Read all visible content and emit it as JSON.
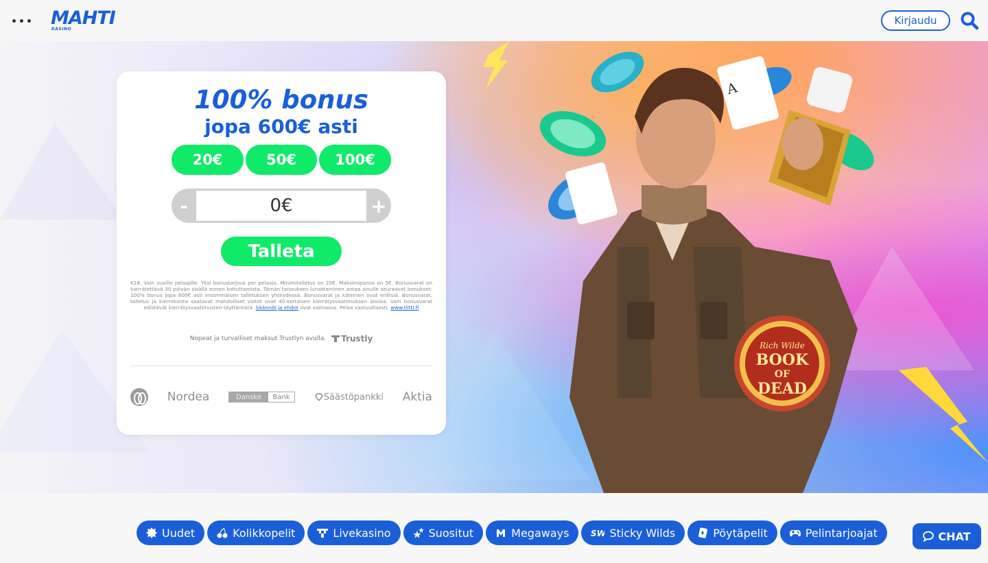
{
  "header": {
    "brand": "MAHTI",
    "brand_sub": "KASINO",
    "login_label": "Kirjaudu"
  },
  "promo": {
    "title": "100% bonus",
    "subtitle": "jopa 600€ asti",
    "amounts": [
      "20€",
      "50€",
      "100€"
    ],
    "stepper": {
      "value": "0€",
      "minus": "-",
      "plus": "+"
    },
    "deposit_label": "Talleta",
    "terms_text": "K18. Vain uusille pelaajille. Yksi bonustarjous per pelaaja. Minimitalletus on 20€. Maksimipanos on 5€. Bonusvarat on kierrätettävä 30 päivän sisällä ennen kotiuttamista. Tämän tarjouksen lunastaminen antaa sinulle seuraavat bonukset: 100% bonus jopa 600€ asti ensimmäisen talletuksen yhteydessä. Bonusvarat ja käteinen ovat erillisiä. Bonusvarat, talletus ja kierroksista saatavat mahdolliset voitot ovat 40-kertaisen kierrätysvaatimuksen alaisia. Vain bonusvarat edistävät kierrätysvaatimusten täyttämistä.",
    "terms_link": "Säännöt ja ehdot",
    "terms_tail": "ovat voimassa. Pelaa vastuullisesti.",
    "terms_url_label": "www.tiltti.fi",
    "trustly_text": "Nopeat ja turvalliset maksut Trustlyn avulla.",
    "trustly_logo": "Trustly",
    "banks": [
      "Nordea",
      "Danske",
      "Bank",
      "Säästöpankki",
      "Aktia"
    ]
  },
  "hero": {
    "game_logo_line1": "Rich Wilde",
    "game_logo_line2": "BOOK",
    "game_logo_line3": "OF",
    "game_logo_line4": "DEAD"
  },
  "categories": [
    {
      "label": "Uudet",
      "icon": "badge-icon"
    },
    {
      "label": "Kolikkopelit",
      "icon": "cherry-icon"
    },
    {
      "label": "Livekasino",
      "icon": "live-icon"
    },
    {
      "label": "Suositut",
      "icon": "stars-icon"
    },
    {
      "label": "Megaways",
      "icon": "megaways-icon"
    },
    {
      "label": "Sticky Wilds",
      "icon": "sw-icon"
    },
    {
      "label": "Pöytäpelit",
      "icon": "card-icon"
    },
    {
      "label": "Pelintarjoajat",
      "icon": "gamepad-icon"
    }
  ],
  "chat_label": "CHAT",
  "colors": {
    "brand_blue": "#1a5fd8",
    "accent_green": "#10ea69",
    "stepper_gray": "#cfcfcf"
  }
}
